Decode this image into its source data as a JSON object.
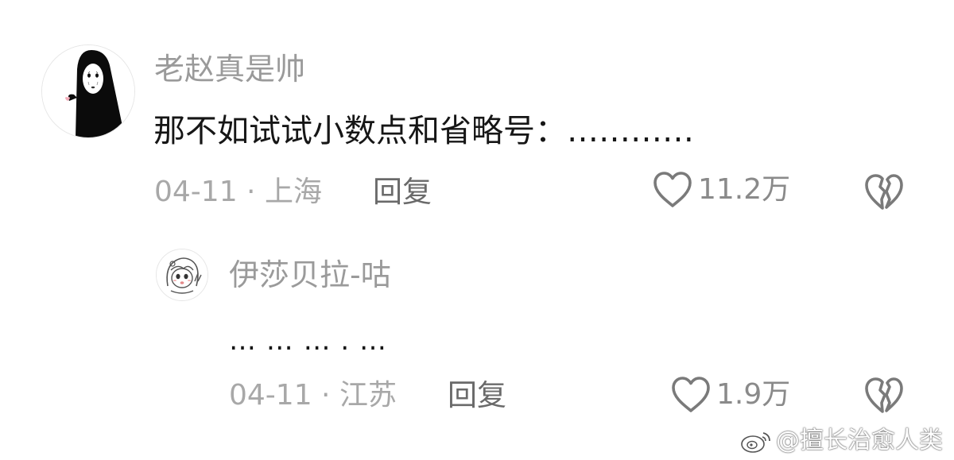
{
  "comment": {
    "avatar_icon": "no-face-spirit-avatar",
    "username": "老赵真是帅",
    "content": "那不如试试小数点和省略号：…………",
    "meta": "04-11 · 上海",
    "reply_label": "回复",
    "like_icon": "heart-outline-icon",
    "like_count": "11.2万",
    "dislike_icon": "broken-heart-icon"
  },
  "reply": {
    "avatar_icon": "anime-girl-sketch-avatar",
    "username": "伊莎贝拉-咕",
    "content": "… … … . …",
    "meta": "04-11 · 江苏",
    "reply_label": "回复",
    "like_icon": "heart-outline-icon",
    "like_count": "1.9万",
    "dislike_icon": "broken-heart-icon"
  },
  "watermark": {
    "icon": "weibo-logo-icon",
    "text": "@擅长治愈人类"
  },
  "colors": {
    "username": "#9a9a9a",
    "content": "#161616",
    "meta": "#a8a8a8",
    "reply_button": "#6a6a6a",
    "icon_stroke": "#7a7a7a"
  }
}
